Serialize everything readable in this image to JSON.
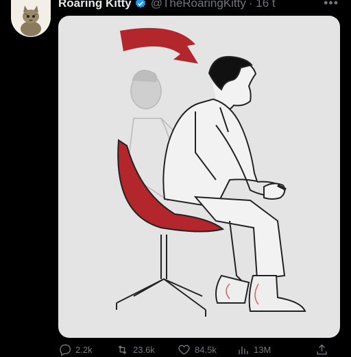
{
  "post": {
    "author_name": "Roaring Kitty",
    "author_handle": "@TheRoaringKitty",
    "time_label": "· 16 t",
    "more_icon": "ellipsis-icon",
    "verified_icon": "verified-badge-icon",
    "verified_color": "#1d9bf0"
  },
  "media": {
    "icon": "illustration-man-leaning-forward-in-chair",
    "arrow_color": "#b3262b",
    "chair_color": "#b3262b"
  },
  "actions": {
    "reply": {
      "icon": "reply-icon",
      "count": "2.2k"
    },
    "repost": {
      "icon": "repost-icon",
      "count": "23.6k"
    },
    "like": {
      "icon": "heart-icon",
      "count": "84.5k"
    },
    "views": {
      "icon": "views-icon",
      "count": "13M"
    },
    "share": {
      "icon": "share-icon"
    }
  },
  "colors": {
    "background": "#000000",
    "text": "#e7e9ea",
    "muted": "#71767b"
  }
}
